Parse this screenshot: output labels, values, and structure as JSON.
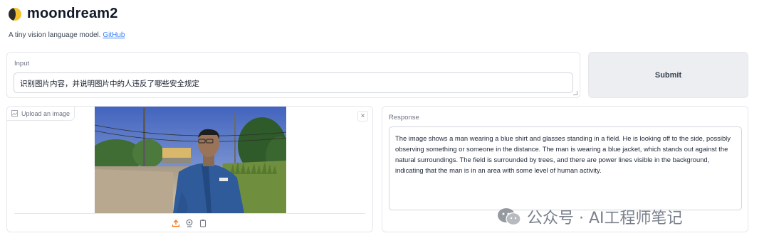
{
  "app": {
    "title": "moondream2",
    "subtitle": "A tiny vision language model.",
    "link_label": "GitHub"
  },
  "input": {
    "label": "Input",
    "value": "识别图片内容，并说明图片中的人违反了哪些安全规定"
  },
  "submit": {
    "label": "Submit"
  },
  "image_panel": {
    "upload_label": "Upload an image",
    "close_glyph": "×",
    "actions": [
      "upload-icon",
      "webcam-icon",
      "clipboard-icon"
    ]
  },
  "response": {
    "label": "Response",
    "text": "The image shows a man wearing a blue shirt and glasses standing in a field. He is looking off to the side, possibly observing something or someone in the distance. The man is wearing a blue jacket, which stands out against the natural surroundings. The field is surrounded by trees, and there are power lines visible in the background, indicating that the man is in an area with some level of human activity."
  },
  "watermark": {
    "text": "公众号 · AI工程师笔记"
  },
  "colors": {
    "accent_link": "#3b82f6",
    "logo_yellow": "#f4c02c",
    "submit_bg": "#eceef1"
  }
}
